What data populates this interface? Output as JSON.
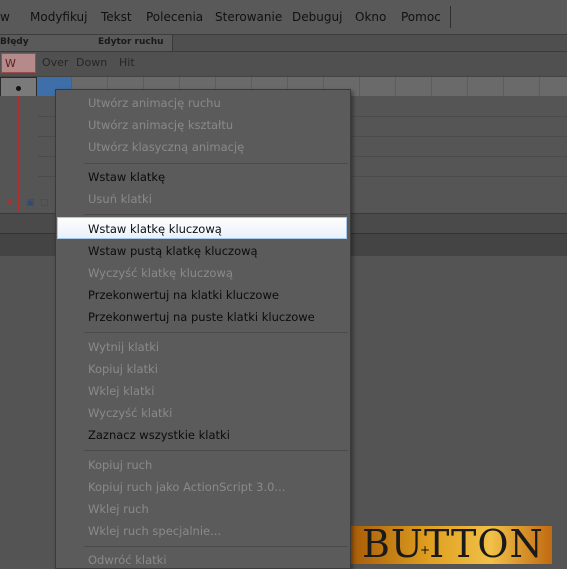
{
  "menubar": {
    "items": [
      "w",
      "Modyfikuj",
      "Tekst",
      "Polecenia",
      "Sterowanie",
      "Debuguj",
      "Okno",
      "Pomoc"
    ]
  },
  "panel_tabs": [
    "Błędy kompilatora",
    "Edytor ruchu"
  ],
  "timeline": {
    "states": [
      "W g...",
      "Over",
      "Down",
      "Hit"
    ]
  },
  "stage": {
    "button_text": "BUTTON",
    "cursor_glyph": "+"
  },
  "context_menu": {
    "groups": [
      [
        {
          "label": "Utwórz animację ruchu",
          "enabled": false
        },
        {
          "label": "Utwórz animację kształtu",
          "enabled": false
        },
        {
          "label": "Utwórz klasyczną animację",
          "enabled": false
        }
      ],
      [
        {
          "label": "Wstaw klatkę",
          "enabled": true
        },
        {
          "label": "Usuń klatki",
          "enabled": false
        }
      ],
      [
        {
          "label": "Wstaw klatkę kluczową",
          "enabled": true,
          "highlighted": true
        },
        {
          "label": "Wstaw pustą klatkę kluczową",
          "enabled": true
        },
        {
          "label": "Wyczyść klatkę kluczową",
          "enabled": false
        },
        {
          "label": "Przekonwertuj na klatki kluczowe",
          "enabled": true
        },
        {
          "label": "Przekonwertuj na puste klatki kluczowe",
          "enabled": true
        }
      ],
      [
        {
          "label": "Wytnij klatki",
          "enabled": false
        },
        {
          "label": "Kopiuj klatki",
          "enabled": false
        },
        {
          "label": "Wklej klatki",
          "enabled": false
        },
        {
          "label": "Wyczyść klatki",
          "enabled": false
        },
        {
          "label": "Zaznacz wszystkie klatki",
          "enabled": true
        }
      ],
      [
        {
          "label": "Kopiuj ruch",
          "enabled": false
        },
        {
          "label": "Kopiuj ruch jako ActionScript 3.0...",
          "enabled": false
        },
        {
          "label": "Wklej ruch",
          "enabled": false
        },
        {
          "label": "Wklej ruch specjalnie...",
          "enabled": false
        }
      ],
      [
        {
          "label": "Odwróć klatki",
          "enabled": false
        }
      ]
    ]
  },
  "colors": {
    "highlight_border": "#a8c8ec",
    "playhead": "#b03030",
    "selected_frame": "#3f6fa8"
  }
}
